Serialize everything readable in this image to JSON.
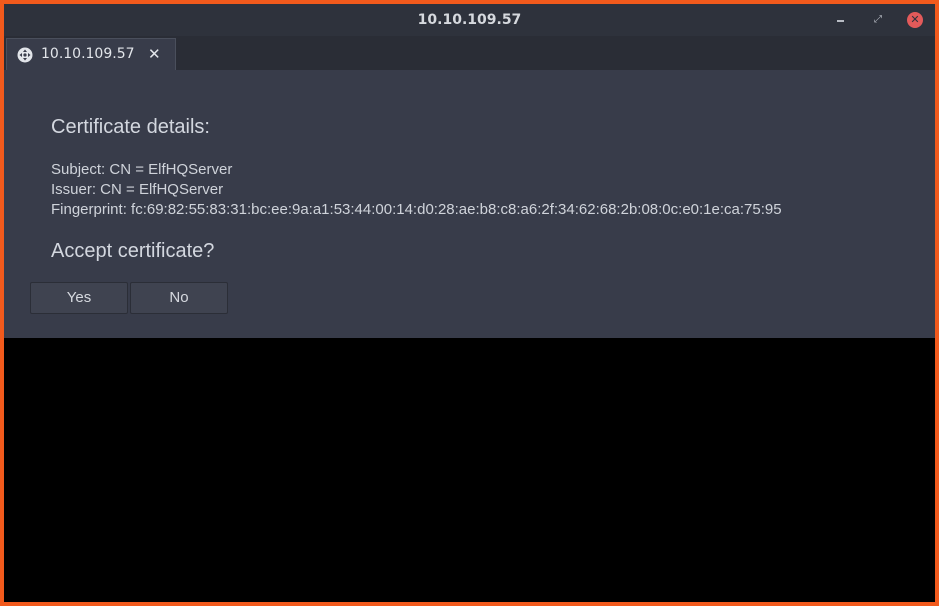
{
  "window": {
    "title": "10.10.109.57",
    "controls": {
      "minimize_icon": "minimize-icon",
      "maximize_icon": "maximize-icon",
      "close_icon": "close-icon",
      "close_glyph": "✕",
      "maximize_glyph": "⤢"
    },
    "colors": {
      "frame": "#f25a1c",
      "titlebar": "#2e323c",
      "content": "#383c4a",
      "close_button": "#e35a5a"
    }
  },
  "tabs": [
    {
      "label": "10.10.109.57",
      "icon": "remote-desktop-icon",
      "close_glyph": "✕"
    }
  ],
  "dialog": {
    "heading": "Certificate details:",
    "subject": "Subject: CN = ElfHQServer",
    "issuer": "Issuer: CN = ElfHQServer",
    "fingerprint": "Fingerprint: fc:69:82:55:83:31:bc:ee:9a:a1:53:44:00:14:d0:28:ae:b8:c8:a6:2f:34:62:68:2b:08:0c:e0:1e:ca:75:95",
    "question": "Accept certificate?",
    "yes_label": "Yes",
    "no_label": "No"
  }
}
